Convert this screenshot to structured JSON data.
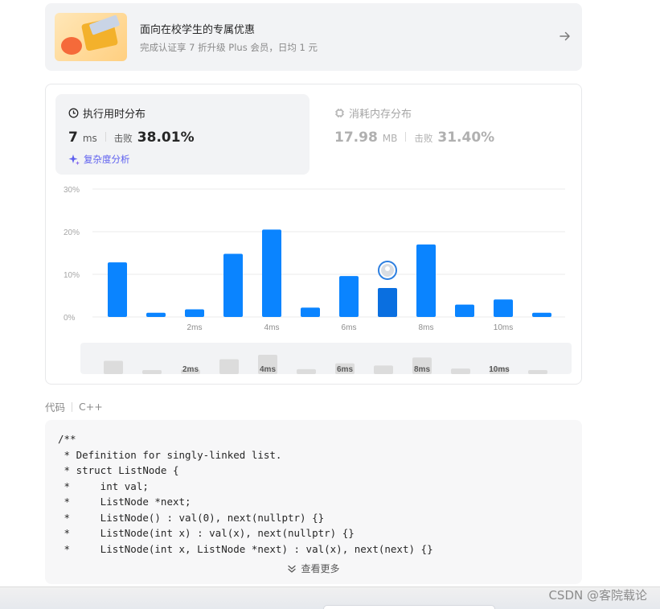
{
  "promo": {
    "title": "面向在校学生的专属优惠",
    "subtitle": "完成认证享 7 折升级 Plus 会员，日均 1 元",
    "arrow_icon": "arrow-right-icon"
  },
  "runtime": {
    "tab_label": "执行用时分布",
    "icon": "clock-icon",
    "value": "7",
    "unit": "ms",
    "beats_label": "击败",
    "beats_value": "38.01%",
    "complexity_label": "复杂度分析"
  },
  "memory": {
    "tab_label": "消耗内存分布",
    "icon": "chip-icon",
    "value": "17.98",
    "unit": "MB",
    "beats_label": "击败",
    "beats_value": "31.40%"
  },
  "chart_data": {
    "type": "bar",
    "yticks": [
      "30%",
      "20%",
      "10%",
      "0%"
    ],
    "ylim": [
      0,
      30
    ],
    "xticks": [
      "2ms",
      "4ms",
      "6ms",
      "8ms",
      "10ms"
    ],
    "values": [
      12.8,
      1.0,
      1.8,
      14.8,
      20.5,
      2.2,
      9.6,
      6.8,
      17.0,
      2.9,
      4.1,
      1.0
    ],
    "highlight_index": 7,
    "colors": {
      "bar": "#0a84ff",
      "highlight": "#0a6fe0",
      "grid": "#ebebeb",
      "mini_bar": "#dcdcdc"
    }
  },
  "code": {
    "language_label": "代码",
    "language": "C++",
    "lines": [
      "/**",
      " * Definition for singly-linked list.",
      " * struct ListNode {",
      " *     int val;",
      " *     ListNode *next;",
      " *     ListNode() : val(0), next(nullptr) {}",
      " *     ListNode(int x) : val(x), next(nullptr) {}",
      " *     ListNode(int x, ListNode *next) : val(x), next(next) {}"
    ],
    "more_label": "查看更多",
    "more_icon": "chevrons-down-icon"
  },
  "watermark": "CSDN @客院载论"
}
